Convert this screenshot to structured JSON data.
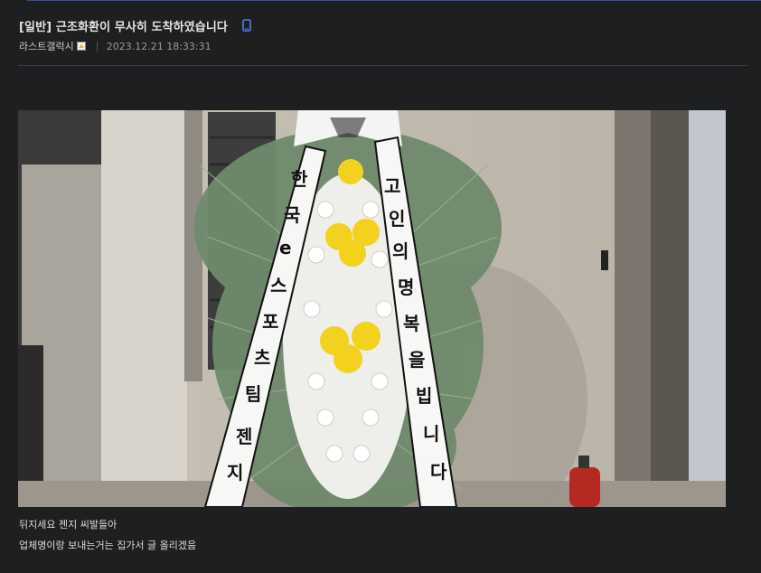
{
  "post": {
    "title": "[일반] 근조화환이 무사히 도착하였습니다",
    "author": "라스트갤럭시",
    "date": "2023.12.21 18:33:31"
  },
  "image": {
    "ribbon_left": [
      "한",
      "국",
      "e",
      "스",
      "포",
      "츠",
      "팀",
      "젠",
      "지"
    ],
    "ribbon_right": [
      "고",
      "인",
      "의",
      "명",
      "복",
      "을",
      "빕",
      "니",
      "다"
    ]
  },
  "body_lines": [
    "뒤지세요 젠지 씨발들아",
    "업체명이랑 보내는거는 집가서 글 올리겠음"
  ],
  "colors": {
    "background": "#1e1f21",
    "accent": "#3b4ea0",
    "text": "#d6d6d6"
  },
  "icons": [
    "mobile-icon",
    "nickname-badge-icon"
  ]
}
